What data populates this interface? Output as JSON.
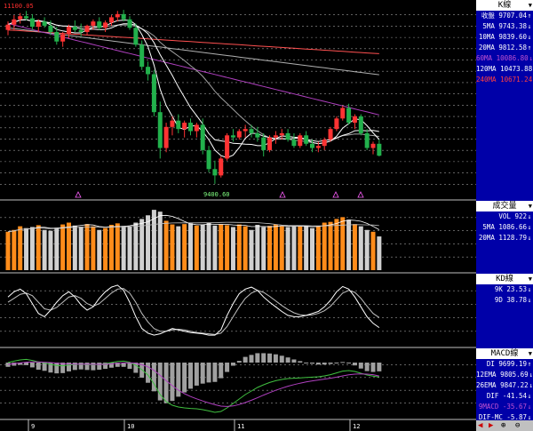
{
  "colors": {
    "up": "#ff3333",
    "down": "#22b14c",
    "vol_up": "#ff8c1a",
    "vol_down": "#d0d0d0",
    "ma5": "#ffffff",
    "ma10": "#ffffff",
    "ma20": "#a0a0a0",
    "ma60": "#b040c0",
    "ma240": "#ff5050",
    "grid": "#ffffff",
    "panel_bg": "#0000a8"
  },
  "chart": {
    "top_label": "11100.05",
    "low_label": "9400.60",
    "x_labels": [
      "9",
      "10",
      "11",
      "12"
    ]
  },
  "k_panel": {
    "title": "K線",
    "rows": [
      {
        "text": "收盤 9707.04",
        "color": "#ffffff",
        "arrow": "↑"
      },
      {
        "text": "5MA 9743.38",
        "color": "#ffffff",
        "arrow": "↓"
      },
      {
        "text": "10MA 9839.60",
        "color": "#ffffff",
        "arrow": "↓"
      },
      {
        "text": "20MA 9812.58",
        "color": "#ffffff",
        "arrow": "↑"
      },
      {
        "text": "60MA 10086.80",
        "color": "#c050d0",
        "arrow": "↓"
      },
      {
        "text": "120MA 10473.88",
        "color": "#ffffff",
        "arrow": "↓"
      },
      {
        "text": "240MA 10671.24",
        "color": "#ff4040",
        "arrow": "↓"
      }
    ]
  },
  "vol_panel": {
    "title": "成交量",
    "rows": [
      {
        "text": "VOL 922",
        "color": "#ffffff",
        "arrow": "↓"
      },
      {
        "text": "5MA 1086.66",
        "color": "#ffffff",
        "arrow": "↓"
      },
      {
        "text": "20MA 1128.79",
        "color": "#ffffff",
        "arrow": "↓"
      }
    ]
  },
  "kd_panel": {
    "title": "KD線",
    "rows": [
      {
        "text": "9K 23.53",
        "color": "#ffffff",
        "arrow": "↓"
      },
      {
        "text": "9D 38.78",
        "color": "#ffffff",
        "arrow": "↓"
      }
    ]
  },
  "macd_panel": {
    "title": "MACD線",
    "rows": [
      {
        "text": "DI 9699.19",
        "color": "#ffffff",
        "arrow": "↑"
      },
      {
        "text": "12EMA 9805.69",
        "color": "#ffffff",
        "arrow": "↓"
      },
      {
        "text": "26EMA 9847.22",
        "color": "#ffffff",
        "arrow": "↓"
      },
      {
        "text": "DIF -41.54",
        "color": "#ffffff",
        "arrow": "↓"
      },
      {
        "text": "9MACD -35.67",
        "color": "#c050d0",
        "arrow": "↓"
      },
      {
        "text": "DIF-MC -5.87",
        "color": "#ffffff",
        "arrow": "↓"
      }
    ]
  },
  "nav": {
    "left": "◀",
    "right": "▶",
    "zoom_in": "⊕",
    "zoom_out": "⊖"
  },
  "chart_data": {
    "type": "candlestick",
    "candles": [
      [
        10900,
        10980,
        10850,
        10950
      ],
      [
        10950,
        11040,
        10900,
        11000
      ],
      [
        11000,
        11060,
        10960,
        11030
      ],
      [
        11030,
        11080,
        10990,
        11010
      ],
      [
        11010,
        11050,
        10900,
        10930
      ],
      [
        10930,
        11000,
        10880,
        10980
      ],
      [
        10980,
        11020,
        10920,
        10940
      ],
      [
        10940,
        10990,
        10850,
        10880
      ],
      [
        10880,
        10930,
        10760,
        10790
      ],
      [
        10790,
        10880,
        10740,
        10860
      ],
      [
        10860,
        10950,
        10820,
        10930
      ],
      [
        10930,
        10990,
        10880,
        10900
      ],
      [
        10900,
        10960,
        10840,
        10880
      ],
      [
        10880,
        10950,
        10850,
        10940
      ],
      [
        10940,
        11000,
        10900,
        10980
      ],
      [
        10980,
        11020,
        10900,
        10920
      ],
      [
        10920,
        10990,
        10880,
        10970
      ],
      [
        10970,
        11040,
        10940,
        11020
      ],
      [
        11020,
        11080,
        10980,
        11050
      ],
      [
        11050,
        11090,
        10980,
        11000
      ],
      [
        11000,
        11030,
        10900,
        10920
      ],
      [
        10920,
        10960,
        10740,
        10760
      ],
      [
        10760,
        10800,
        10520,
        10550
      ],
      [
        10550,
        10600,
        10420,
        10480
      ],
      [
        10480,
        10520,
        10080,
        10120
      ],
      [
        10120,
        10220,
        9680,
        9780
      ],
      [
        9780,
        10020,
        9740,
        9980
      ],
      [
        9980,
        10080,
        9900,
        10040
      ],
      [
        10040,
        10100,
        9920,
        9960
      ],
      [
        9960,
        10040,
        9880,
        10020
      ],
      [
        10020,
        10060,
        9900,
        9940
      ],
      [
        9940,
        10020,
        9880,
        10000
      ],
      [
        10000,
        10060,
        9720,
        9760
      ],
      [
        9760,
        9800,
        9550,
        9580
      ],
      [
        9580,
        9660,
        9440,
        9520
      ],
      [
        9520,
        9700,
        9500,
        9680
      ],
      [
        9680,
        9920,
        9660,
        9900
      ],
      [
        9900,
        9960,
        9840,
        9880
      ],
      [
        9880,
        9960,
        9860,
        9940
      ],
      [
        9940,
        10000,
        9880,
        9960
      ],
      [
        9960,
        10000,
        9880,
        9920
      ],
      [
        9920,
        9980,
        9840,
        9880
      ],
      [
        9880,
        9920,
        9700,
        9760
      ],
      [
        9760,
        9900,
        9740,
        9880
      ],
      [
        9880,
        9940,
        9820,
        9900
      ],
      [
        9900,
        9960,
        9860,
        9920
      ],
      [
        9920,
        9960,
        9840,
        9860
      ],
      [
        9860,
        9920,
        9780,
        9800
      ],
      [
        9800,
        9920,
        9780,
        9900
      ],
      [
        9900,
        9940,
        9800,
        9820
      ],
      [
        9820,
        9860,
        9740,
        9780
      ],
      [
        9780,
        9840,
        9740,
        9800
      ],
      [
        9800,
        9880,
        9760,
        9860
      ],
      [
        9860,
        9980,
        9840,
        9960
      ],
      [
        9960,
        10080,
        9940,
        10060
      ],
      [
        10060,
        10180,
        10040,
        10160
      ],
      [
        10160,
        10200,
        10000,
        10020
      ],
      [
        10020,
        10100,
        9960,
        10080
      ],
      [
        10080,
        10100,
        9900,
        9920
      ],
      [
        9920,
        9960,
        9760,
        9780
      ],
      [
        9780,
        9840,
        9720,
        9820
      ],
      [
        9820,
        9860,
        9700,
        9707
      ]
    ],
    "ma_series": [
      "5MA",
      "10MA",
      "20MA",
      "60MA",
      "120MA",
      "240MA"
    ],
    "volume": [
      1050,
      1100,
      1200,
      1150,
      1180,
      1230,
      1100,
      1080,
      1160,
      1250,
      1300,
      1220,
      1190,
      1260,
      1200,
      1100,
      1150,
      1240,
      1280,
      1210,
      1200,
      1300,
      1400,
      1500,
      1650,
      1600,
      1350,
      1250,
      1200,
      1260,
      1280,
      1220,
      1250,
      1300,
      1220,
      1260,
      1230,
      1180,
      1250,
      1200,
      1100,
      1240,
      1180,
      1210,
      1250,
      1200,
      1180,
      1190,
      1200,
      1220,
      1150,
      1210,
      1300,
      1320,
      1400,
      1450,
      1380,
      1260,
      1200,
      1100,
      1050,
      922
    ],
    "kd": {
      "k": [
        70,
        78,
        82,
        75,
        60,
        45,
        40,
        50,
        62,
        72,
        78,
        70,
        58,
        50,
        55,
        68,
        78,
        85,
        88,
        80,
        62,
        40,
        22,
        15,
        12,
        14,
        18,
        22,
        20,
        18,
        16,
        15,
        14,
        12,
        12,
        20,
        42,
        60,
        75,
        82,
        85,
        80,
        70,
        62,
        55,
        48,
        42,
        40,
        40,
        42,
        45,
        48,
        55,
        65,
        78,
        86,
        82,
        70,
        55,
        40,
        30,
        23.53
      ],
      "d": [
        62,
        68,
        74,
        76,
        72,
        62,
        52,
        50,
        54,
        62,
        70,
        72,
        68,
        60,
        56,
        60,
        68,
        76,
        82,
        83,
        76,
        62,
        45,
        32,
        22,
        18,
        18,
        20,
        21,
        20,
        18,
        16,
        15,
        14,
        13,
        15,
        25,
        40,
        55,
        68,
        76,
        80,
        77,
        71,
        64,
        57,
        51,
        46,
        43,
        42,
        43,
        45,
        49,
        56,
        66,
        76,
        80,
        77,
        68,
        56,
        45,
        38.78
      ]
    },
    "macd": {
      "dif": [
        40,
        48,
        55,
        58,
        52,
        44,
        38,
        30,
        24,
        22,
        26,
        30,
        32,
        30,
        28,
        30,
        34,
        40,
        46,
        48,
        42,
        25,
        0,
        -30,
        -80,
        -140,
        -180,
        -200,
        -210,
        -215,
        -218,
        -220,
        -225,
        -232,
        -240,
        -235,
        -215,
        -190,
        -165,
        -140,
        -120,
        -100,
        -85,
        -72,
        -62,
        -55,
        -50,
        -48,
        -46,
        -44,
        -42,
        -40,
        -35,
        -28,
        -18,
        -8,
        -5,
        -10,
        -20,
        -30,
        -36,
        -41.54
      ],
      "macd": [
        30,
        34,
        38,
        42,
        44,
        44,
        42,
        40,
        37,
        34,
        32,
        31,
        31,
        31,
        30,
        30,
        31,
        33,
        36,
        38,
        39,
        36,
        28,
        16,
        -4,
        -32,
        -62,
        -90,
        -115,
        -135,
        -151,
        -164,
        -176,
        -187,
        -197,
        -205,
        -207,
        -204,
        -196,
        -185,
        -172,
        -158,
        -143,
        -129,
        -116,
        -104,
        -93,
        -84,
        -76,
        -69,
        -63,
        -58,
        -53,
        -48,
        -42,
        -35,
        -29,
        -25,
        -24,
        -25,
        -28,
        -35.67
      ]
    },
    "x_labels": [
      "9",
      "10",
      "11",
      "12"
    ],
    "annotations": [
      "11100.05",
      "9400.60"
    ]
  }
}
